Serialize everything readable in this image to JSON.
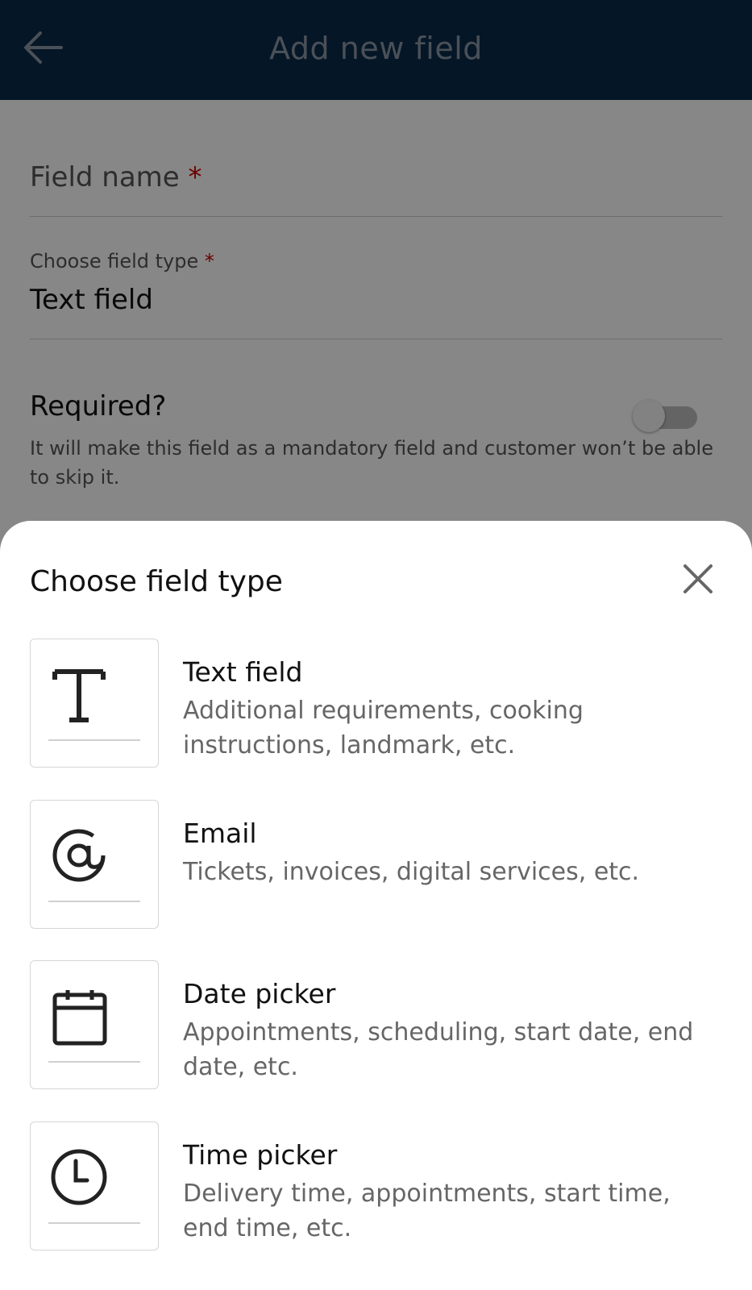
{
  "header": {
    "title": "Add new field"
  },
  "form": {
    "field_name_label": "Field name",
    "required_star": "*",
    "field_type_label": "Choose field type",
    "field_type_value": "Text field",
    "required_label": "Required?",
    "required_desc": "It will make this field as a mandatory field and customer won’t be able to skip it.",
    "required_toggle_on": false
  },
  "sheet": {
    "title": "Choose field type",
    "options": [
      {
        "name": "Text field",
        "desc": "Additional requirements, cooking instructions, landmark, etc.",
        "icon": "text-icon"
      },
      {
        "name": "Email",
        "desc": "Tickets, invoices, digital services, etc.",
        "icon": "at-icon"
      },
      {
        "name": "Date picker",
        "desc": "Appointments, scheduling, start date, end date, etc.",
        "icon": "calendar-icon"
      },
      {
        "name": "Time picker",
        "desc": "Delivery time, appointments, start time, end time, etc.",
        "icon": "clock-icon"
      }
    ]
  },
  "colors": {
    "header_bg": "#0a2a48",
    "required_star": "#cc0000",
    "overlay": "rgba(0,0,0,0.47)"
  }
}
